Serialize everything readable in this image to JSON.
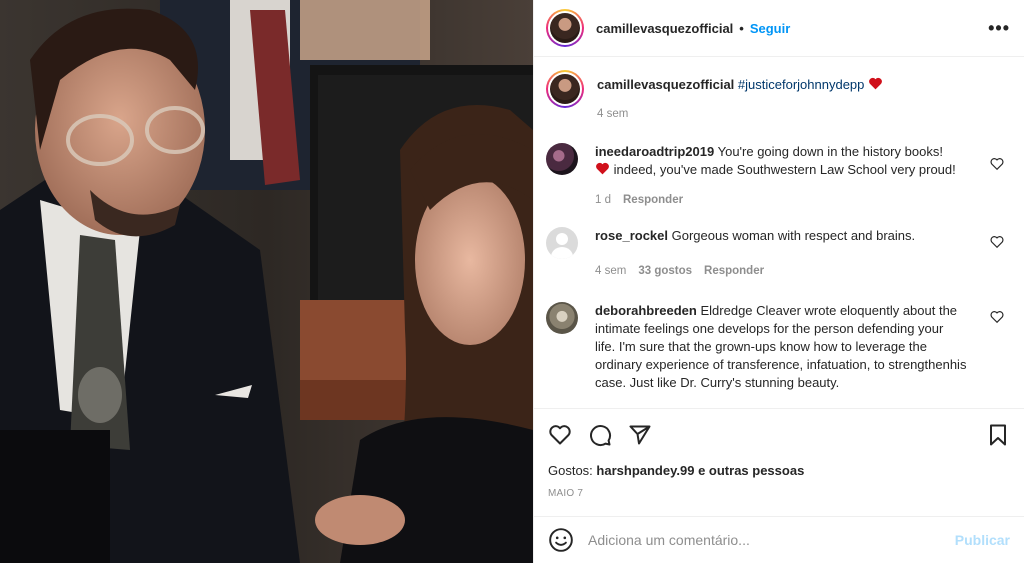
{
  "post": {
    "username": "camillevasquezofficial",
    "separator": "•",
    "follow_label": "Seguir",
    "more_label": "•••",
    "caption_hashtag": "#justiceforjohnnydepp",
    "caption_time": "4 sem"
  },
  "comments": [
    {
      "username": "ineedaroadtrip2019",
      "text_line1": "You're going down in the history books!",
      "text_line2": "indeed, you've made Southwestern Law School very proud!",
      "time": "1 d",
      "reply_label": "Responder"
    },
    {
      "username": "rose_rockel",
      "text": "Gorgeous woman with respect and brains.",
      "time": "4 sem",
      "likes": "33 gostos",
      "reply_label": "Responder"
    },
    {
      "username": "deborahbreeden",
      "text": "Eldredge Cleaver wrote eloquently about the intimate feelings one develops for the person defending your life. I'm sure that the grown-ups know how to leverage the ordinary experience of transference, infatuation, to strengthenhis case. Just like Dr. Curry's stunning beauty."
    }
  ],
  "actions": {
    "likes_prefix": "Gostos:",
    "likes_user": "harshpandey.99",
    "likes_suffix": "e outras pessoas",
    "date": "MAIO 7"
  },
  "composer": {
    "placeholder": "Adiciona um comentário...",
    "publish_label": "Publicar"
  },
  "icons": [
    "heart-icon",
    "comment-icon",
    "share-icon",
    "bookmark-icon",
    "emoji-icon",
    "more-icon"
  ],
  "colors": {
    "link": "#0095f6",
    "hashtag": "#00376b",
    "heart": "#ed4956",
    "muted": "#8e8e8e"
  }
}
